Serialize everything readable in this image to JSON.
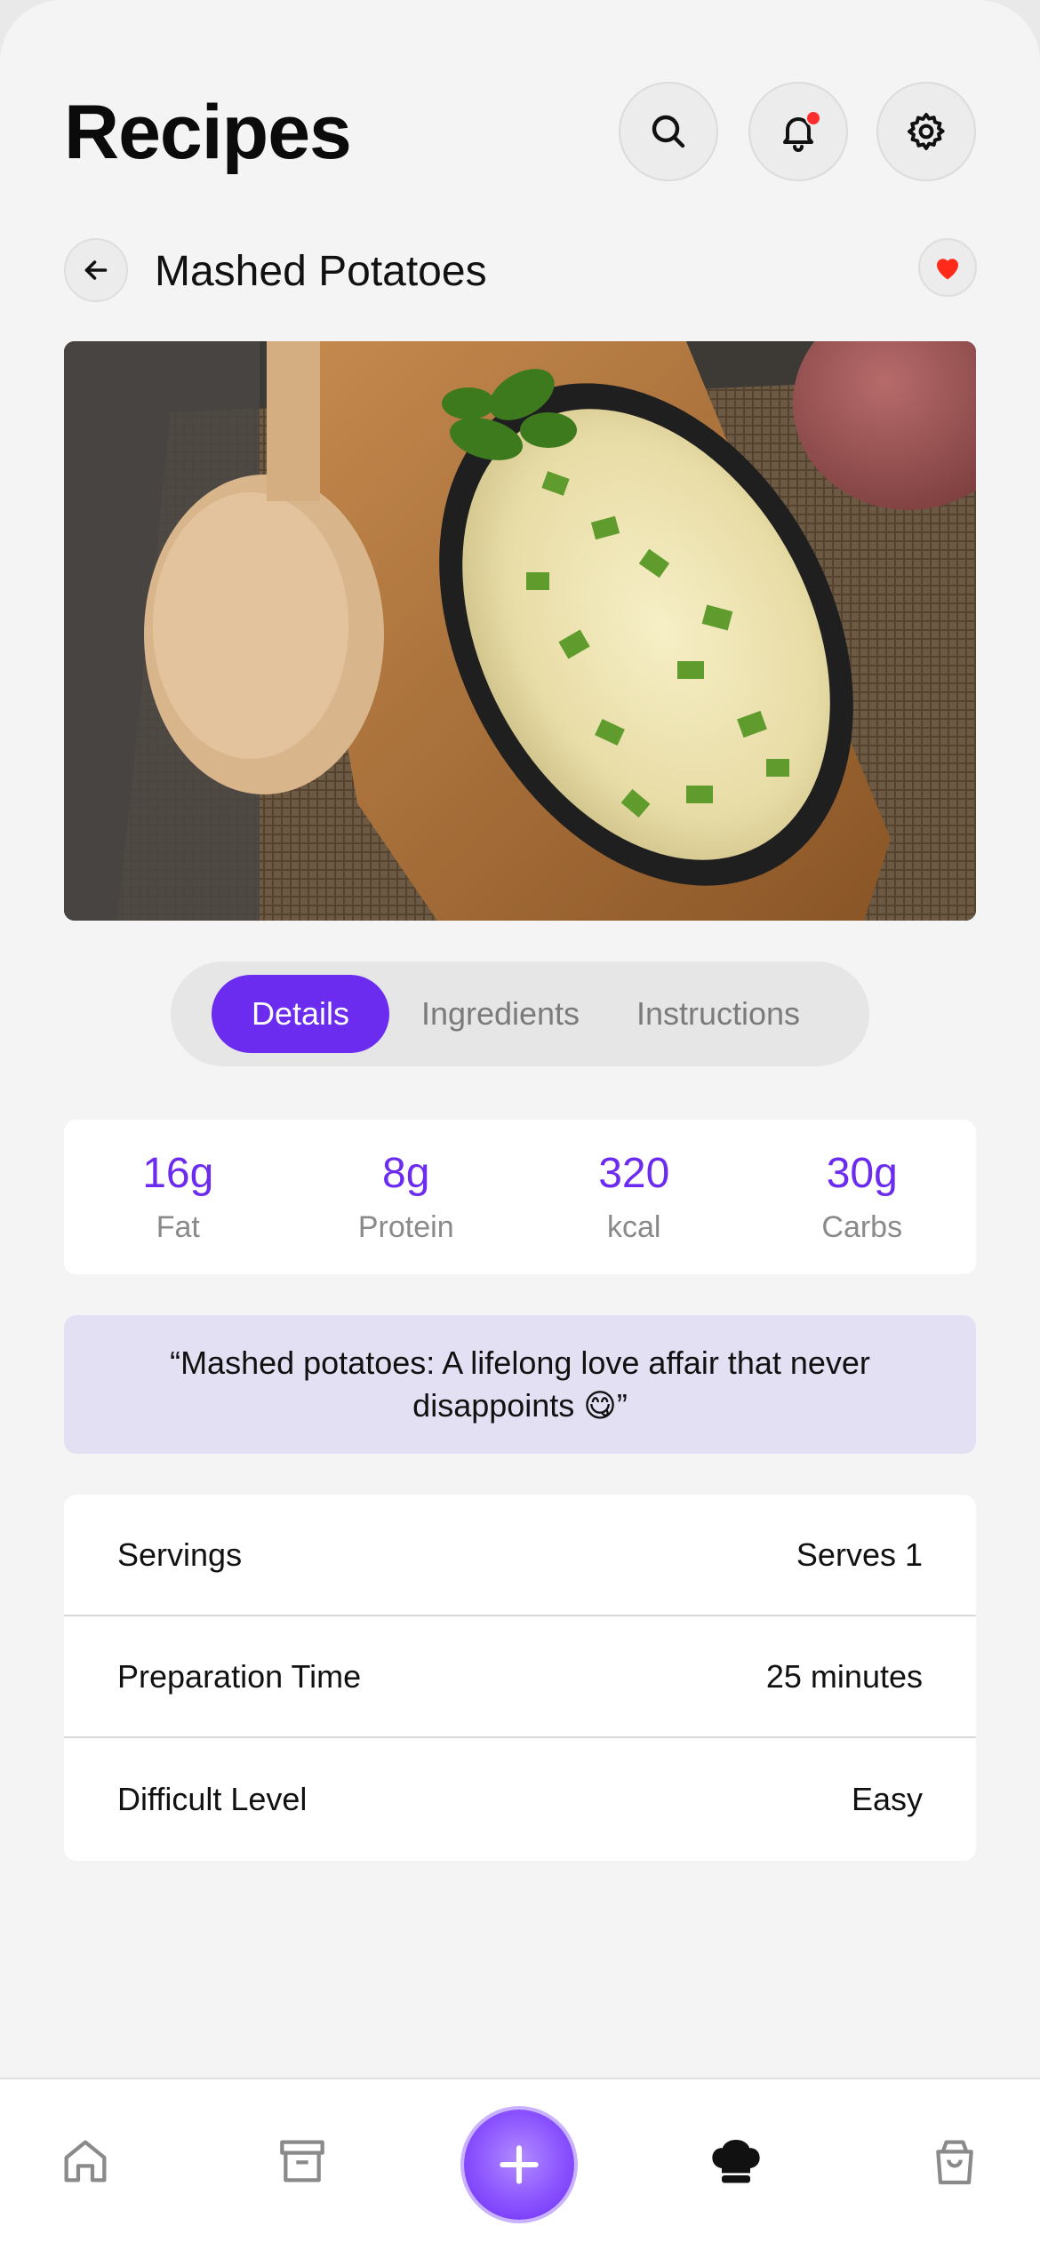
{
  "header": {
    "title": "Recipes"
  },
  "recipe": {
    "title": "Mashed Potatoes"
  },
  "tabs": [
    {
      "label": "Details",
      "active": true
    },
    {
      "label": "Ingredients",
      "active": false
    },
    {
      "label": "Instructions",
      "active": false
    }
  ],
  "nutrition": [
    {
      "value": "16g",
      "label": "Fat"
    },
    {
      "value": "8g",
      "label": "Protein"
    },
    {
      "value": "320",
      "label": "kcal"
    },
    {
      "value": "30g",
      "label": "Carbs"
    }
  ],
  "quote": "“Mashed potatoes: A lifelong love affair that never disappoints 😋”",
  "info": [
    {
      "label": "Servings",
      "value": "Serves 1"
    },
    {
      "label": "Preparation Time",
      "value": "25 minutes"
    },
    {
      "label": "Difficult Level",
      "value": "Easy"
    }
  ],
  "colors": {
    "accent": "#6c2cf0",
    "favorite": "#ff2a1a",
    "quote_bg": "#e4e0f4"
  },
  "icons": [
    "search-icon",
    "bell-icon",
    "gear-icon",
    "arrow-left-icon",
    "heart-icon",
    "home-icon",
    "archive-icon",
    "plus-icon",
    "chef-hat-icon",
    "shopping-bag-icon"
  ]
}
